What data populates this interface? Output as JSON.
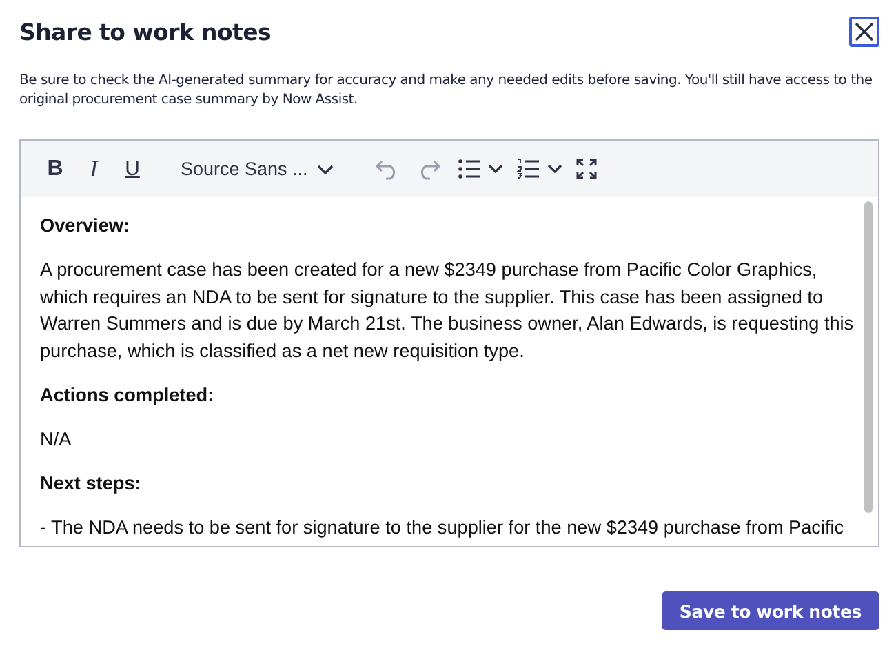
{
  "dialog": {
    "title": "Share to work notes"
  },
  "description": "Be sure to check the AI-generated summary for accuracy and make any needed edits before saving. You'll still have access to the original procurement case summary by Now Assist.",
  "toolbar": [
    {
      "kind": "bold",
      "label": "B",
      "disabled": false
    },
    {
      "kind": "italic",
      "label": "I",
      "disabled": false
    },
    {
      "kind": "underline",
      "label": "U",
      "disabled": false
    },
    {
      "kind": "font",
      "label": "Source Sans ...",
      "disabled": false
    },
    {
      "kind": "undo",
      "disabled": true
    },
    {
      "kind": "redo",
      "disabled": true
    },
    {
      "kind": "bullets",
      "disabled": false
    },
    {
      "kind": "numbers",
      "disabled": false
    },
    {
      "kind": "fullscreen",
      "disabled": false
    }
  ],
  "content": [
    {
      "kind": "heading",
      "text": "Overview:"
    },
    {
      "kind": "paragraph",
      "text": "A procurement case has been created for a new $2349 purchase from Pacific Color Graphics, which requires an NDA to be sent for signature to the supplier. This case has been assigned to Warren Summers and is due by March 21st. The business owner, Alan Edwards, is requesting this purchase, which is classified as a net new requisition type."
    },
    {
      "kind": "heading",
      "text": "Actions completed:"
    },
    {
      "kind": "paragraph",
      "text": "N/A"
    },
    {
      "kind": "heading",
      "text": "Next steps:"
    },
    {
      "kind": "paragraph",
      "text": "- The NDA needs to be sent for signature to the supplier for the new $2349 purchase from Pacific"
    }
  ],
  "save_button": "Save to work notes"
}
